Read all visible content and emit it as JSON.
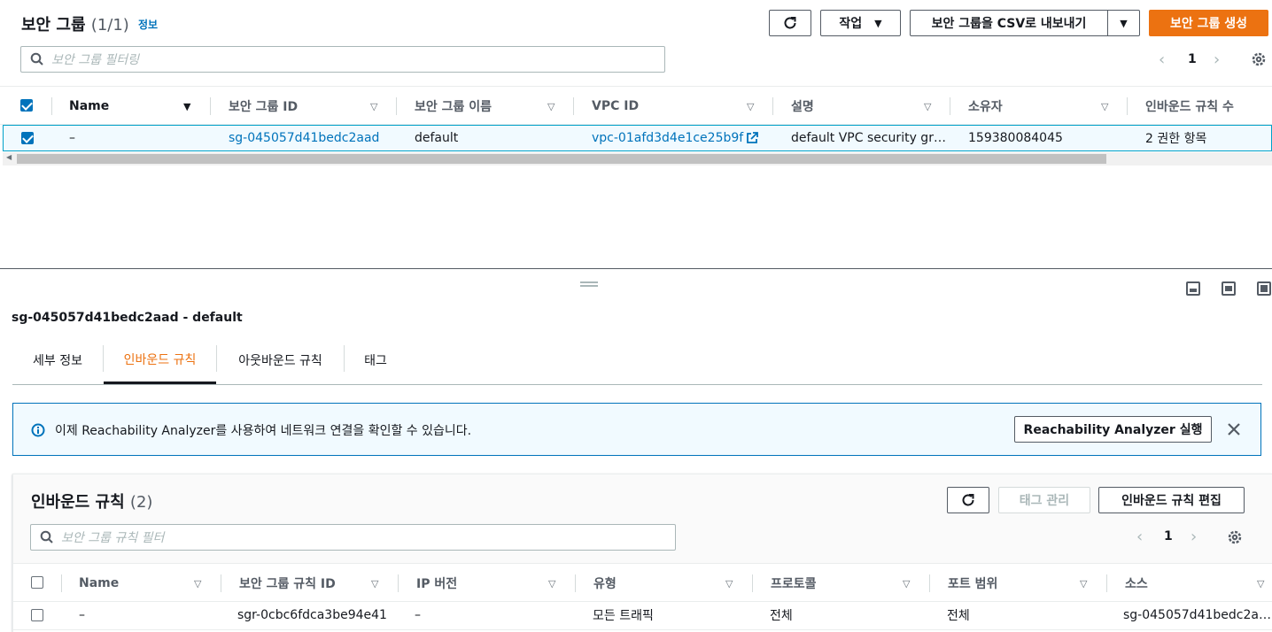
{
  "top": {
    "title": "보안 그룹",
    "count": "(1/1)",
    "info_link": "정보",
    "actions_label": "작업",
    "export_label": "보안 그룹을 CSV로 내보내기",
    "create_label": "보안 그룹 생성",
    "search_placeholder": "보안 그룹 필터링",
    "page": "1",
    "columns": [
      "Name",
      "보안 그룹 ID",
      "보안 그룹 이름",
      "VPC ID",
      "설명",
      "소유자",
      "인바운드 규칙 수"
    ],
    "row": {
      "name": "–",
      "sg_id": "sg-045057d41bedc2aad",
      "sg_name": "default",
      "vpc_id": "vpc-01afd3d4e1ce25b9f",
      "description": "default VPC security gr…",
      "owner": "159380084045",
      "inbound_count": "2 권한 항목"
    }
  },
  "detail": {
    "title": "sg-045057d41bedc2aad - default",
    "tabs": [
      "세부 정보",
      "인바운드 규칙",
      "아웃바운드 규칙",
      "태그"
    ],
    "active_tab": 1,
    "notice_text": "이제 Reachability Analyzer를 사용하여 네트워크 연결을 확인할 수 있습니다.",
    "notice_button": "Reachability Analyzer 실행",
    "accent_color": "#ec7211",
    "link_color": "#0073bb"
  },
  "inbound": {
    "title": "인바운드 규칙",
    "count": "(2)",
    "manage_tags_label": "태그 관리",
    "edit_label": "인바운드 규칙 편집",
    "search_placeholder": "보안 그룹 규칙 필터",
    "page": "1",
    "columns": [
      "Name",
      "보안 그룹 규칙 ID",
      "IP 버전",
      "유형",
      "프로토콜",
      "포트 범위",
      "소스"
    ],
    "row": {
      "name": "–",
      "rule_id": "sgr-0cbc6fdca3be94e41",
      "ip_version": "–",
      "type": "모든 트래픽",
      "protocol": "전체",
      "port_range": "전체",
      "source": "sg-045057d41bedc2a…"
    }
  }
}
